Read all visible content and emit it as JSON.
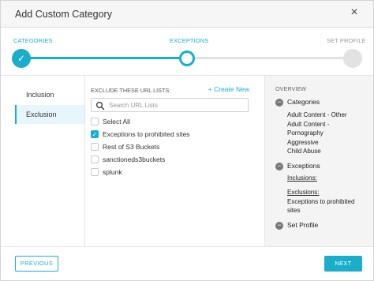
{
  "dialog": {
    "title": "Add Custom Category",
    "close_icon": "×"
  },
  "stepper": {
    "steps": [
      {
        "label": "CATEGORIES",
        "state": "done"
      },
      {
        "label": "EXCEPTIONS",
        "state": "current"
      },
      {
        "label": "SET PROFILE",
        "state": "todo"
      }
    ],
    "accent_color": "#1aaecb"
  },
  "left_nav": {
    "items": [
      {
        "label": "Inclusion",
        "active": false
      },
      {
        "label": "Exclusion",
        "active": true
      }
    ]
  },
  "exclusion": {
    "heading": "EXCLUDE THESE URL LISTS:",
    "create_link": "+ Create New",
    "search_placeholder": "Search URL Lists",
    "list": [
      {
        "label": "Select All",
        "checked": false
      },
      {
        "label": "Exceptions to prohibited sites",
        "checked": true
      },
      {
        "label": "Rest of S3 Buckets",
        "checked": false
      },
      {
        "label": "sanctioneds3buckets",
        "checked": false
      },
      {
        "label": "splunk",
        "checked": false
      }
    ]
  },
  "overview": {
    "heading": "OVERVIEW",
    "categories_label": "Categories",
    "categories": [
      "Adult Content - Other",
      "Adult Content -",
      "Pornography",
      "Aggressive",
      "Child Abuse"
    ],
    "exceptions_label": "Exceptions",
    "inclusions_label": "Inclusions:",
    "exclusions_label": "Exclusions:",
    "exclusions": [
      "Exceptions to prohibited",
      "sites"
    ],
    "set_profile_label": "Set Profile"
  },
  "footer": {
    "previous_label": "PREVIOUS",
    "next_label": "NEXT"
  }
}
